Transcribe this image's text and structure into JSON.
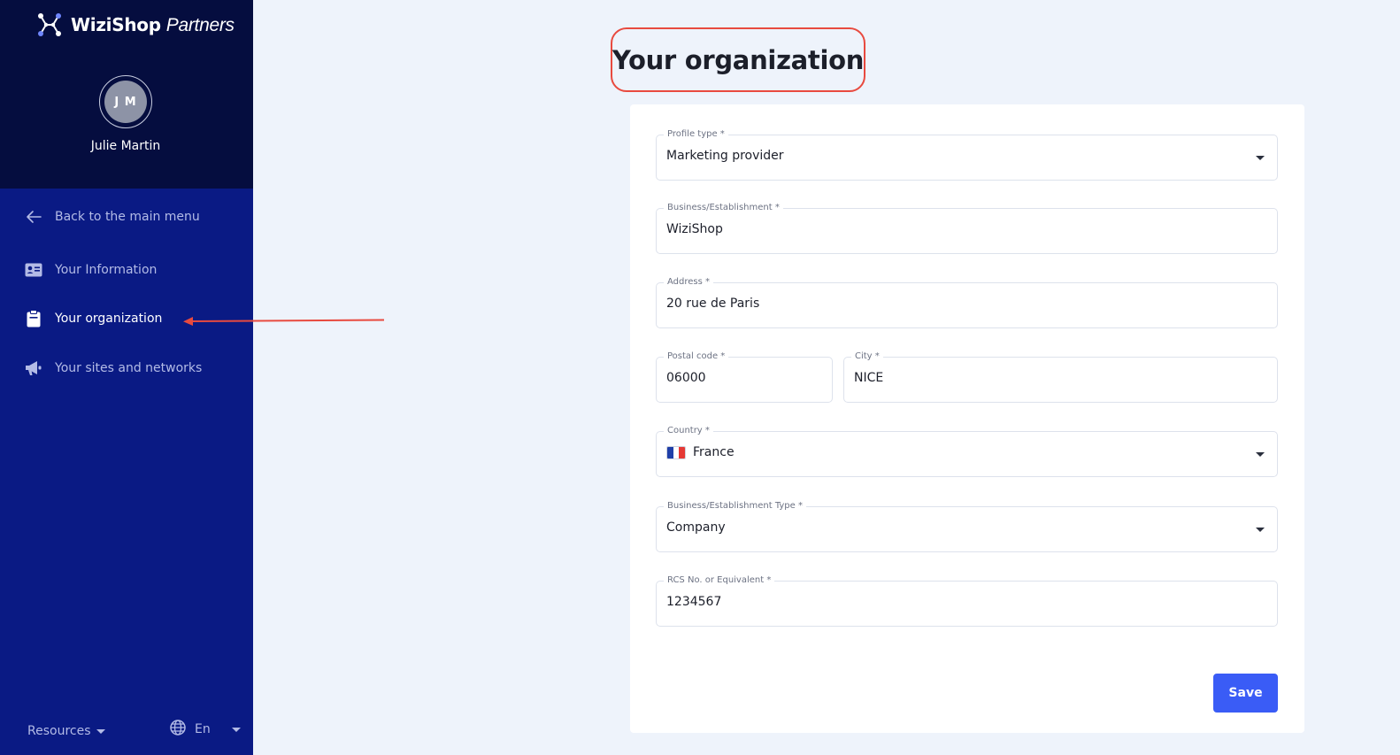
{
  "brand": {
    "name": "WiziShop",
    "suffix": "Partners"
  },
  "user": {
    "initials": "J M",
    "name": "Julie Martin"
  },
  "nav": {
    "back": "Back to the main menu",
    "items": [
      {
        "label": "Your Information",
        "icon": "id-card-icon",
        "active": false
      },
      {
        "label": "Your organization",
        "icon": "clipboard-icon",
        "active": true
      },
      {
        "label": "Your sites and networks",
        "icon": "megaphone-icon",
        "active": false
      }
    ]
  },
  "footer": {
    "resources": "Resources",
    "language": "En"
  },
  "page": {
    "title": "Your organization"
  },
  "form": {
    "profile_type": {
      "label": "Profile type *",
      "value": "Marketing provider"
    },
    "business": {
      "label": "Business/Establishment *",
      "value": "WiziShop"
    },
    "address": {
      "label": "Address *",
      "value": "20 rue de Paris"
    },
    "postal_code": {
      "label": "Postal code *",
      "value": "06000"
    },
    "city": {
      "label": "City *",
      "value": "NICE"
    },
    "country": {
      "label": "Country *",
      "value": "France"
    },
    "business_type": {
      "label": "Business/Establishment Type *",
      "value": "Company"
    },
    "rcs": {
      "label": "RCS No. or Equivalent *",
      "value": "1234567"
    },
    "save_label": "Save"
  },
  "colors": {
    "sidebar": "#0a1a84",
    "sidebar_top": "#050d3f",
    "accent": "#3a5cf6",
    "annotation": "#e84a3f",
    "background": "#eef3fb"
  }
}
